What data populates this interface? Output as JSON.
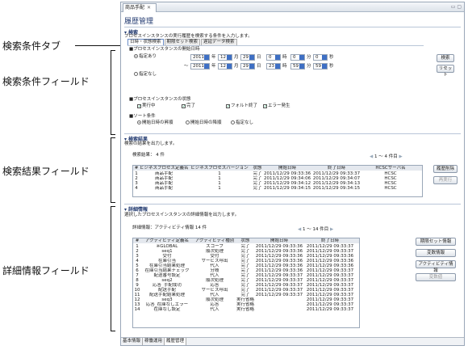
{
  "annotations": {
    "tab": "検索条件タブ",
    "fields": "検索条件フィールド",
    "results": "検索結果フィールド",
    "detail": "詳細情報フィールド"
  },
  "window": {
    "tab_label": "商品手配",
    "title": "履歴管理"
  },
  "search": {
    "header": "検索",
    "desc": "プロセスインスタンスの実行履歴を検索する条件を入力します。",
    "tabs": [
      "日時・状態検索",
      "期限セット検索",
      "遅延データ検索"
    ],
    "start_label": "■プロセスインスタンスの開始日時",
    "opt_specified": "指定あり",
    "opt_none": "指定なし",
    "from": {
      "year": "2011",
      "month": "12",
      "day": "29",
      "hour": "0",
      "min": "0",
      "sec": "0"
    },
    "to": {
      "year": "2011",
      "month": "12",
      "day": "29",
      "hour": "23",
      "min": "59",
      "sec": "59"
    },
    "u_year": "年",
    "u_month": "月",
    "u_day": "日",
    "u_hour": "時",
    "u_min": "分",
    "u_sec": "秒",
    "tilde": "～",
    "state_label": "■プロセスインスタンスの状態",
    "states": [
      "実行中",
      "完了",
      "フォルト終了",
      "エラー発生"
    ],
    "sort_label": "■ソート条件",
    "sorts": [
      "開始日時の昇順",
      "開始日時の降順",
      "指定なし"
    ],
    "btn_search": "検索",
    "btn_reset": "リセット"
  },
  "results": {
    "header": "検索結果",
    "desc": "検索の結果を出力します。",
    "count_label": "検索結果：",
    "count": "4",
    "count_unit": "件",
    "pager": "1 ～ 4 件目",
    "columns": [
      "#",
      "ビジネスプロセス定義名",
      "ビジネスプロセスバージョン",
      "状態",
      "開始日時",
      "終了日時",
      "HCSCサーバ名"
    ],
    "rows": [
      [
        "1",
        "商品手配",
        "1",
        "完了",
        "2011/12/29 09:33:36",
        "2011/12/29 09:33:37",
        "HCSC"
      ],
      [
        "2",
        "商品手配",
        "1",
        "完了",
        "2011/12/29 09:34:06",
        "2011/12/29 09:34:07",
        "HCSC"
      ],
      [
        "3",
        "商品手配",
        "1",
        "完了",
        "2011/12/29 09:34:12",
        "2011/12/29 09:34:13",
        "HCSC"
      ],
      [
        "4",
        "商品手配",
        "1",
        "完了",
        "2011/12/29 09:34:15",
        "2011/12/29 09:34:15",
        "HCSC"
      ]
    ],
    "btn_delete": "履歴削除",
    "btn_rerun": "再実行"
  },
  "detail": {
    "header": "詳細情報",
    "desc": "選択したプロセスインスタンスの詳細情報を出力します。",
    "count_label": "詳細情報：アクティビティ情報",
    "count": "14",
    "count_unit": "件",
    "pager": "1 ～ 14 件目",
    "columns": [
      "#",
      "アクティビティ定義名",
      "アクティビティ種別",
      "状態",
      "開始日時",
      "終了日時"
    ],
    "rows": [
      [
        "1",
        "※GLOBAL",
        "スコープ",
        "完了",
        "2011/12/29 09:33:36",
        "2011/12/29 09:33:37"
      ],
      [
        "2",
        "seq1",
        "順次処理",
        "完了",
        "2011/12/29 09:33:36",
        "2011/12/29 09:33:37"
      ],
      [
        "3",
        "受付",
        "受付",
        "完了",
        "2011/12/29 09:33:36",
        "2011/12/29 09:33:36"
      ],
      [
        "4",
        "在庫引当",
        "サービス呼出",
        "完了",
        "2011/12/29 09:33:36",
        "2011/12/29 09:33:36"
      ],
      [
        "5",
        "在庫引当結果処理",
        "代入",
        "完了",
        "2011/12/29 09:33:36",
        "2011/12/29 09:33:36"
      ],
      [
        "6",
        "在庫引当結果チェック",
        "分岐",
        "完了",
        "2011/12/29 09:33:36",
        "2011/12/29 09:33:37"
      ],
      [
        "7",
        "配送番号設定",
        "代入",
        "完了",
        "2011/12/29 09:33:37",
        "2011/12/29 09:33:37"
      ],
      [
        "8",
        "seq2",
        "順次処理",
        "完了",
        "2011/12/29 09:33:37",
        "2011/12/29 09:33:37"
      ],
      [
        "9",
        "応答_手配成功",
        "応答",
        "完了",
        "2011/12/29 09:33:37",
        "2011/12/29 09:33:37"
      ],
      [
        "10",
        "配送手配",
        "サービス呼出",
        "完了",
        "2011/12/29 09:33:37",
        "2011/12/29 09:33:37"
      ],
      [
        "11",
        "配送手配結果処理",
        "代入",
        "完了",
        "2011/12/29 09:33:37",
        "2011/12/29 09:33:37"
      ],
      [
        "12",
        "seq3",
        "順次処理",
        "実行省略",
        "",
        "2011/12/29 09:33:37"
      ],
      [
        "13",
        "応答_在庫なしエラー",
        "応答",
        "実行省略",
        "",
        "2011/12/29 09:33:37"
      ],
      [
        "14",
        "在庫なし設定",
        "代入",
        "実行省略",
        "",
        "2011/12/29 09:33:37"
      ]
    ],
    "btn_period": "期限セット情報",
    "btn_var": "変数情報",
    "btn_act": "アクティビティ情報",
    "btn_varedit": "変数値"
  },
  "bottom_tabs": [
    "基本情報",
    "稼働運用",
    "履歴管理"
  ]
}
